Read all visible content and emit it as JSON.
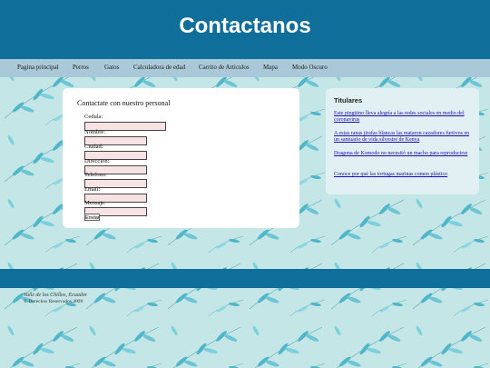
{
  "header": {
    "title": "Contactanos"
  },
  "nav": {
    "items": [
      {
        "label": "Pagina principal"
      },
      {
        "label": "Perros"
      },
      {
        "label": "Gatos"
      },
      {
        "label": "Calculadora de edad"
      },
      {
        "label": "Carrito de Articulos"
      },
      {
        "label": "Mapa"
      },
      {
        "label": "Modo Oscuro"
      }
    ]
  },
  "form": {
    "title": "Contactate con nuestro personal",
    "fields": [
      {
        "label": "Cedula:",
        "value": ""
      },
      {
        "label": "Nombre:",
        "value": ""
      },
      {
        "label": "Ciudad:",
        "value": ""
      },
      {
        "label": "Direccion:",
        "value": ""
      },
      {
        "label": "Telefono:",
        "value": ""
      },
      {
        "label": "Email:",
        "value": ""
      },
      {
        "label": "Mensaje:",
        "value": ""
      }
    ],
    "submit_label": "Enviar"
  },
  "sidebar": {
    "title": "Titulares",
    "links": [
      {
        "text": "Este pingüino lleva alegría a las redes sociales en medio del coronavirus"
      },
      {
        "text": "A estas ranas jirafas blancas las mataron cazadores furtivos en un santuario de vida silvestre de Kenya"
      },
      {
        "text": "Dragona de Komodo no necesitó un macho para reproducirse"
      },
      {
        "text": "Conoce por qué las tortugas marinas comen plástico"
      }
    ]
  },
  "footer": {
    "location": "Valle de los Chillos, Ecuador",
    "copyright": "© Derechos Reservados 2020"
  },
  "colors": {
    "header": "#0f6f9a",
    "nav": "#a9c8d8",
    "background": "#c4e6e6",
    "leaf": "#4fb6c9",
    "link": "#1a0dab",
    "input_fill": "#f7e2e4"
  }
}
